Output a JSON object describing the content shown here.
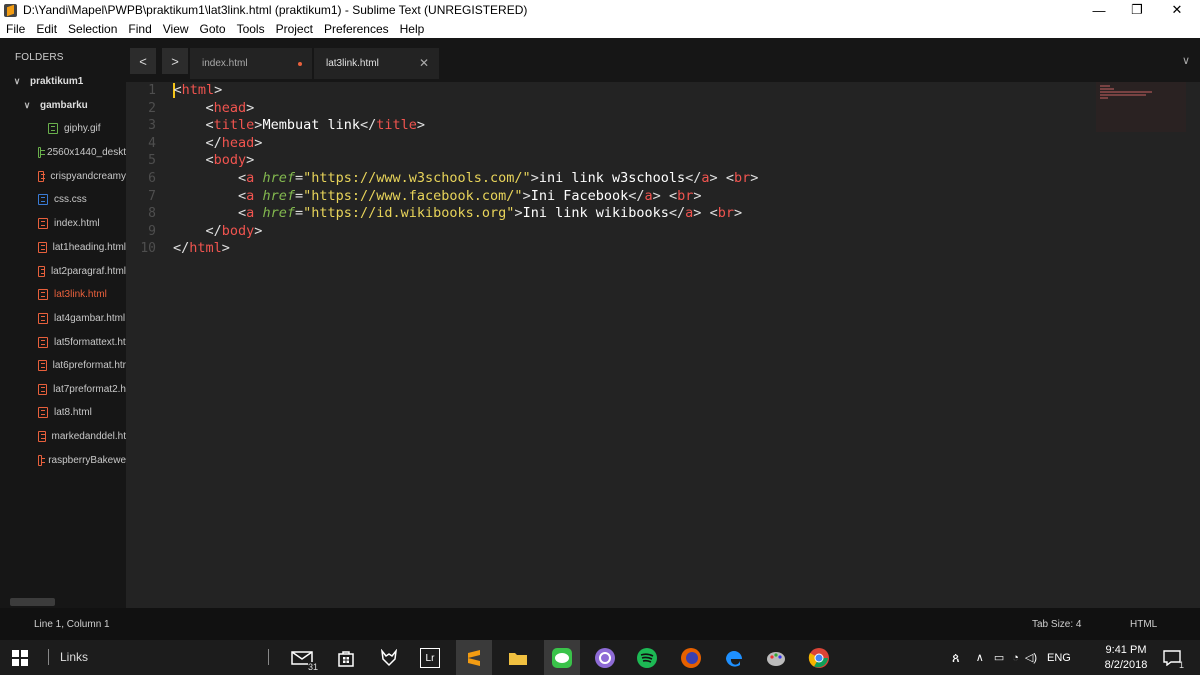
{
  "window": {
    "title": "D:\\Yandi\\Mapel\\PWPB\\praktikum1\\lat3link.html (praktikum1) - Sublime Text (UNREGISTERED)",
    "minimize": "—",
    "maximize": "❐",
    "close": "✕"
  },
  "menu": [
    "File",
    "Edit",
    "Selection",
    "Find",
    "View",
    "Goto",
    "Tools",
    "Project",
    "Preferences",
    "Help"
  ],
  "sidebar": {
    "header": "FOLDERS",
    "items": [
      {
        "label": "praktikum1",
        "kind": "folder",
        "depth": 0
      },
      {
        "label": "gambarku",
        "kind": "folder",
        "depth": 1
      },
      {
        "label": "giphy.gif",
        "kind": "image",
        "depth": 2
      },
      {
        "label": "2560x1440_deskt",
        "kind": "image",
        "depth": 1
      },
      {
        "label": "crispyandcreamy",
        "kind": "html",
        "depth": 1
      },
      {
        "label": "css.css",
        "kind": "css",
        "depth": 1
      },
      {
        "label": "index.html",
        "kind": "html",
        "depth": 1
      },
      {
        "label": "lat1heading.html",
        "kind": "html",
        "depth": 1
      },
      {
        "label": "lat2paragraf.html",
        "kind": "html",
        "depth": 1
      },
      {
        "label": "lat3link.html",
        "kind": "html",
        "depth": 1,
        "active": true
      },
      {
        "label": "lat4gambar.html",
        "kind": "html",
        "depth": 1
      },
      {
        "label": "lat5formattext.ht",
        "kind": "html",
        "depth": 1
      },
      {
        "label": "lat6preformat.htr",
        "kind": "html",
        "depth": 1
      },
      {
        "label": "lat7preformat2.h",
        "kind": "html",
        "depth": 1
      },
      {
        "label": "lat8.html",
        "kind": "html",
        "depth": 1
      },
      {
        "label": "markedanddel.ht",
        "kind": "html",
        "depth": 1
      },
      {
        "label": "raspberryBakewe",
        "kind": "html",
        "depth": 1
      }
    ]
  },
  "tabs": {
    "back": "<",
    "forward": ">",
    "items": [
      {
        "label": "index.html",
        "active": false
      },
      {
        "label": "lat3link.html",
        "active": true
      }
    ],
    "close_glyph": "✕",
    "menu_glyph": "∨"
  },
  "editor": {
    "line_numbers": [
      "1",
      "2",
      "3",
      "4",
      "5",
      "6",
      "7",
      "8",
      "9",
      "10"
    ],
    "lines": [
      [
        "<html>"
      ],
      [
        "    <head>"
      ],
      [
        "    <title>Membuat link</title>"
      ],
      [
        "    </head>"
      ],
      [
        "    <body>"
      ],
      [
        "        <a href=\"https://www.w3schools.com/\">ini link w3schools</a> <br>"
      ],
      [
        "        <a href=\"https://www.facebook.com/\">Ini Facebook</a> <br>"
      ],
      [
        "        <a href=\"https://id.wikibooks.org\">Ini link wikibooks</a> <br>"
      ],
      [
        "    </body>"
      ],
      [
        "</html>"
      ]
    ]
  },
  "statusbar": {
    "position": "Line 1, Column 1",
    "tab_size": "Tab Size: 4",
    "syntax": "HTML"
  },
  "taskbar": {
    "search_label": "Links",
    "mail_badge": "31",
    "lightroom": "Lr",
    "language": "ENG",
    "time": "9:41 PM",
    "date": "8/2/2018",
    "notification_badge": "1"
  },
  "colors": {
    "accent": "#e8603c",
    "tag": "#f0544f",
    "attr": "#83b94f",
    "string": "#e8d45a",
    "background": "#232323"
  }
}
